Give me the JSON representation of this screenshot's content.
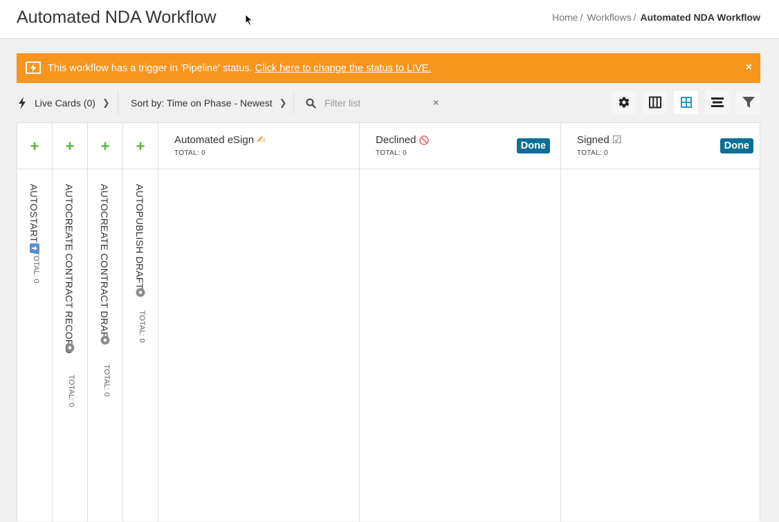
{
  "header": {
    "title": "Automated NDA Workflow",
    "breadcrumb": [
      "Home",
      "Workflows",
      "Automated NDA Workflow"
    ],
    "breadcrumb_sep": "/"
  },
  "banner": {
    "text": "This workflow has a trigger in 'Pipeline' status.",
    "link": "Click here to change the status to LIVE.",
    "close": "×",
    "color": "#f7951e"
  },
  "toolbar": {
    "live_cards": "Live Cards (0)",
    "sort": "Sort by: Time on Phase - Newest",
    "search_placeholder": "Filter list",
    "clear": "×"
  },
  "phases_collapsed": [
    {
      "name": "AUTOSTART",
      "total": "TOTAL: 0",
      "icon": "arrow-right-icon"
    },
    {
      "name": "AUTOCREATE CONTRACT RECORD",
      "total": "TOTAL: 0",
      "icon": "gear-icon"
    },
    {
      "name": "AUTOCREATE CONTRACT DRAFT",
      "total": "TOTAL: 0",
      "icon": "gear-icon"
    },
    {
      "name": "AUTOPUBLISH DRAFT",
      "total": "TOTAL: 0",
      "icon": "gear-icon"
    }
  ],
  "phases": [
    {
      "name": "Automated eSign",
      "emoji": "✍",
      "total": "TOTAL: 0",
      "badge": ""
    },
    {
      "name": "Declined",
      "emoji": "🚫",
      "total": "TOTAL: 0",
      "badge": "Done"
    },
    {
      "name": "Signed",
      "emoji": "☑",
      "total": "TOTAL: 0",
      "badge": "Done"
    }
  ],
  "add_symbol": "+",
  "colors": {
    "accent_green": "#5fb336",
    "done_badge": "#0e6f95",
    "active_view": "#2196d3"
  }
}
